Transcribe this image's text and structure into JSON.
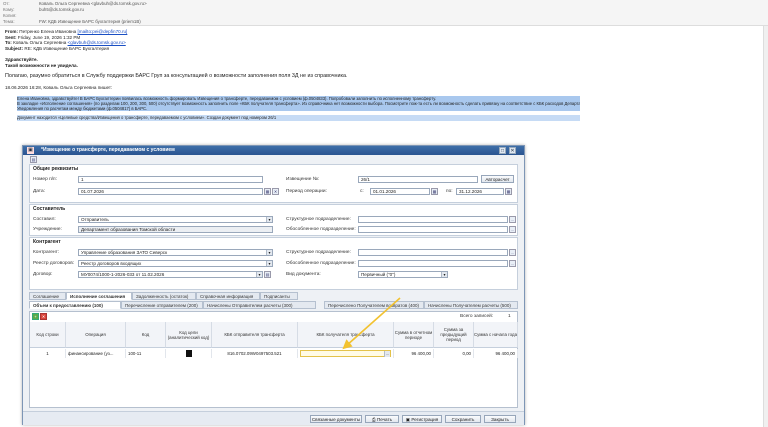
{
  "email_header": {
    "from_label": "От:",
    "from_value": "Коваль Ольга Сергеевна <glavbuh@ds.tomsk.gov.ru>",
    "to_label": "Кому:",
    "to_value": "buh5@ds.tomsk.gov.ru",
    "cc_label": "Копия:",
    "cc_value": "",
    "subject_label": "Тема:",
    "subject_value": "FW: КДБ Извещение БАРС бухгалтерия (priem1B)"
  },
  "email_body": {
    "from_line_label": "From:",
    "from_line_value": "Петренко Елена Ивановна",
    "from_line_link": "[mailto:pei@depfin70.ru]",
    "sent_label": "Sent:",
    "sent_value": "Friday, June 19, 2026 1:32 PM",
    "to_label": "To:",
    "to_value": "Коваль Ольга Сергеевна",
    "to_link": "<glavbuh@ds.tomsk.gov.ru>",
    "subject_label": "Subject:",
    "subject_value": "RE: КДБ Извещение БАРС Бухгалтерия",
    "greeting": "Здравствуйте.",
    "line1": "Такой возможности не увидела.",
    "line2": "Полагаю, разумно обратиться в Службу поддержки БАРС Груп за консультацией о возможности заполнения поля 3Д не из справочника.",
    "quote_header": "18.06.2026 16:28, Коваль Ольга Сергеевна пишет:",
    "q1": "Елена Ивановна, здравствуйте! В БАРС Бухгалтерии появилась возможность формировать Извещения о трансферте, передаваемом с условием (ф.0504833). Попробовали заполнить по исполненному трансферту.",
    "q2": "В закладке «Исполнение соглашения» (по разделам 100, 200, 300, 500) отсутствует возможность заполнить поле «КБК получателя трансферта». Из справочника нет возможности выбора. Посмотрите пож-та есть ли возможность сделать привязку на соответствие с КБК расходов Департамента как при заполнении",
    "q3": "Уведомления по расчетам между бюджетами (ф.0504817) в БАРС.",
    "q4": "Документ находится «Целевые средства/Извещения о трансферте, передаваемом с условием». Создан документ под номером 26/1"
  },
  "window": {
    "title": "*Извещение о трансферте, передаваемом с условием",
    "section_general": "Общие реквизиты",
    "num_label": "Номер п/п:",
    "num_value": "1",
    "notice_label": "Извещение №:",
    "notice_value": "26/1",
    "autocalc_button": "Авторасчет",
    "date_label": "Дата:",
    "date_value": "01.07.2026",
    "period_label": "Период операции:",
    "period_from_label": "с:",
    "period_from_value": "01.01.2026",
    "period_to_label": "по:",
    "period_to_value": "31.12.2026",
    "section_composer": "Составитель",
    "composer_label": "Составил:",
    "composer_value": "Отправитель",
    "struct_label": "Структурное подразделение:",
    "struct_value": "",
    "institution_label": "Учреждение:",
    "institution_value": "Департамент образования Томской области",
    "separate_label": "Обособленное подразделение:",
    "separate_value": "",
    "section_counterparty": "Контрагент",
    "counterparty_label": "Контрагент:",
    "counterparty_value": "Управление образования ЗАТО Северск",
    "struct2_label": "Структурное подразделение:",
    "struct2_value": "",
    "registry_label": "Реестр договоров:",
    "registry_value": "Реестр договоров входящих",
    "separate2_label": "Обособленное подразделение:",
    "separate2_value": "",
    "contract_label": "Договор:",
    "contract_value": "МУ0074/1000-1-2026-033 от 11.02.2026",
    "doctype_label": "Вид документа:",
    "doctype_value": "Первичный (\"0\")",
    "tabs1": [
      "Соглашение",
      "Исполнение соглашения",
      "Задолженность (остаток)",
      "Справочная информация",
      "Подписанты"
    ],
    "tabs2": [
      "Объем к предоставлению (100)",
      "Перечисление отправителем (200)",
      "Начислены Отправителем расчеты (300)",
      "Перечислено Получателем возвратов (400)",
      "Начислены Получателем расчеты (500)"
    ],
    "total_label": "Всего записей:",
    "total_value": "1",
    "columns": [
      "Код строки",
      "Операция",
      "Код",
      "Код цели (аналитический код)",
      "КБК отправителя трансферта",
      "КБК получателя трансферта",
      "Сумма в отчетном периоде",
      "Сумма за предыдущий период",
      "Сумма с начала года"
    ],
    "row": [
      "1",
      "финансирование (уз...",
      "100-11",
      "",
      "816.0702.09W0497503.521",
      "",
      "96 400,00",
      "0,00",
      "96 400,00"
    ],
    "footer_buttons": [
      "Связанные документы",
      "Печать",
      "Регистрация",
      "Сохранить",
      "Закрыть"
    ]
  },
  "colors": {
    "title_bar": "#2a5490",
    "highlight": "#a9c8ee",
    "arrow": "#f2c230"
  }
}
